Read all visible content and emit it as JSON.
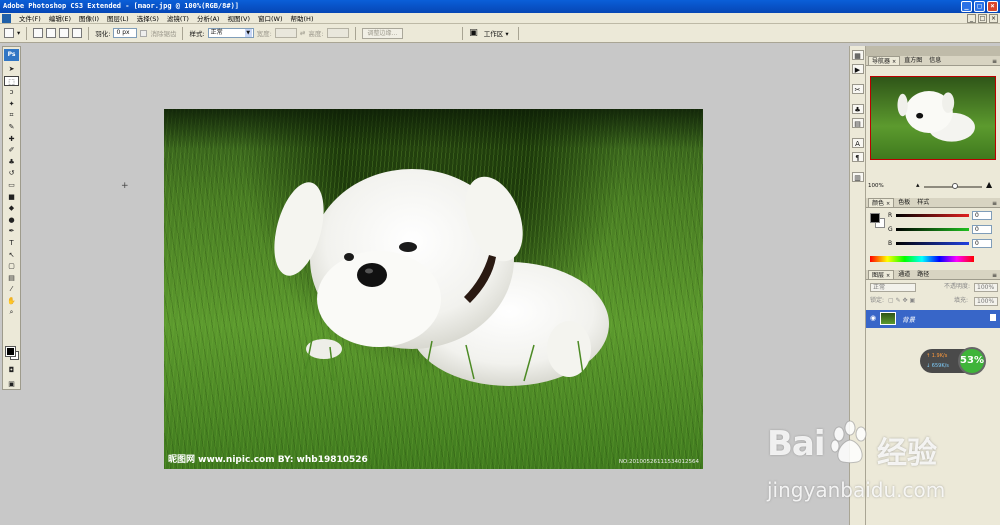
{
  "window": {
    "title": "Adobe Photoshop CS3 Extended - [maor.jpg @ 100%(RGB/8#)]"
  },
  "menu": [
    "文件(F)",
    "编辑(E)",
    "图像(I)",
    "图层(L)",
    "选择(S)",
    "滤镜(T)",
    "分析(A)",
    "视图(V)",
    "窗口(W)",
    "帮助(H)"
  ],
  "options": {
    "feather_label": "羽化:",
    "feather_value": "0 px",
    "antialias_label": "消除锯齿",
    "style_label": "样式:",
    "style_value": "正常",
    "width_label": "宽度:",
    "height_label": "高度:",
    "refine_edge": "调整边缘...",
    "workspace": "工作区 ▾"
  },
  "toolbox": {
    "logo": "Ps"
  },
  "canvas": {
    "watermark_left": "昵图网 www.nipic.com  BY: whb19810526",
    "watermark_right": "NO:20100526111534012564"
  },
  "navigator": {
    "tabs": [
      "导航器",
      "直方图",
      "信息"
    ],
    "zoom": "100%"
  },
  "color_panel": {
    "tabs": [
      "颜色",
      "色板",
      "样式"
    ],
    "channels": [
      {
        "label": "R",
        "value": "0",
        "color": "#e02020"
      },
      {
        "label": "G",
        "value": "0",
        "color": "#20c020"
      },
      {
        "label": "B",
        "value": "0",
        "color": "#2040e0"
      }
    ]
  },
  "layers_panel": {
    "tabs": [
      "图层",
      "通道",
      "路径"
    ],
    "blend_mode": "正常",
    "opacity_label": "不透明度:",
    "opacity_value": "100%",
    "lock_label": "锁定:",
    "fill_label": "填充:",
    "fill_value": "100%",
    "layer_name": "背景"
  },
  "speed_widget": {
    "up": "1.9K/s",
    "down": "659K/s",
    "percent": "53%"
  },
  "overlay": {
    "brand_left": "Bai",
    "brand_right": "经验",
    "url": "jingyanbaidu.com"
  }
}
